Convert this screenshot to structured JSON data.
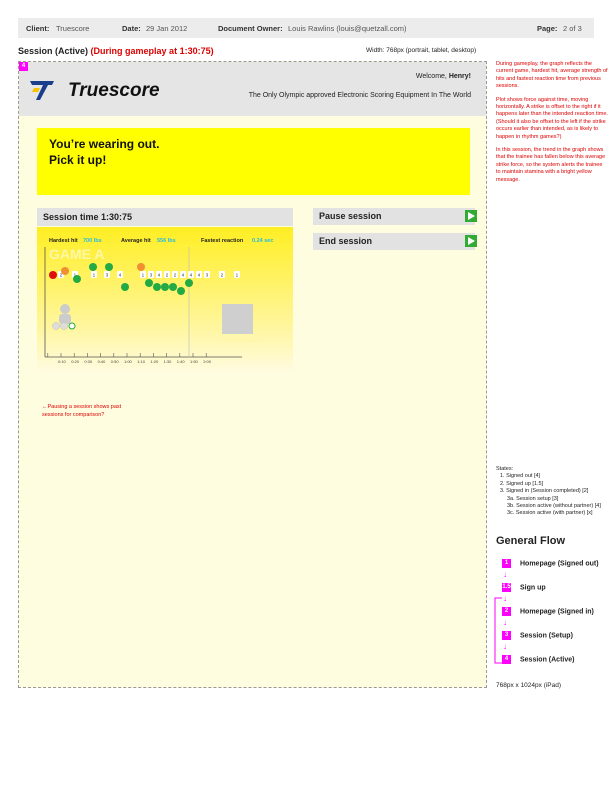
{
  "header": {
    "client_label": "Client:",
    "client": "Truescore",
    "date_label": "Date:",
    "date": "29 Jan 2012",
    "owner_label": "Document Owner:",
    "owner": "Louis Rawlins (louis@quetzall.com)",
    "page_label": "Page:",
    "page": "2 of 3"
  },
  "title": {
    "main": "Session (Active)",
    "highlight": "(During gameplay at 1:30:75)"
  },
  "width_note": "Width: 768px (portrait, tablet, desktop)",
  "screen": {
    "badge": "4",
    "brand": "Truescore",
    "welcome_prefix": "Welcome, ",
    "welcome_name": "Henry!",
    "tagline": "The Only Olympic approved Electronic Scoring Equipment In The World",
    "alert_line1": "You’re wearing out.",
    "alert_line2": "Pick it up!",
    "session_time": "Session time 1:30:75",
    "pause_button": "Pause session",
    "end_button": "End session",
    "pause_note": "←Pausing a session shows past sessions for comparison?"
  },
  "chart_data": {
    "type": "scatter",
    "title": "GAME A",
    "stats": {
      "hardest_label": "Hardest hit",
      "hardest_value": "700 lbs",
      "average_label": "Average hit",
      "average_value": "556 lbs",
      "fastest_label": "Fastest reaction",
      "fastest_value": "0.24 sec"
    },
    "x_ticks": [
      "0:10",
      "0:20",
      "0:30",
      "0:40",
      "0:50",
      "1:00",
      "1:10",
      "1:20",
      "1:30",
      "1:40",
      "1:50",
      "2:00"
    ],
    "current_time": "1:30",
    "image_label": "FOR YOUR BOOK",
    "hit_labels": [
      "2",
      "1",
      "1",
      "3",
      "4",
      "1",
      "3",
      "4",
      "2",
      "2",
      "4",
      "4",
      "4",
      "3",
      "2",
      "1"
    ],
    "colors": {
      "strong": "#22aa44",
      "weak": "#f09030",
      "miss": "#e01010",
      "accent": "#22bbdd"
    }
  },
  "side_notes": [
    "During gameplay, the graph reflects the current game, hardest hit, average strength of hits and fastest reaction time from previous sessions.",
    "Plot shows force against time, moving horizontally. A strike is offset to the right if it happens later than the intended reaction time. (Should it also be offset to the left if the strike occurs earlier than intended, as is likely to happen in rhythm games?)",
    "In this session, the trend in the graph shows that the trainee has fallen below this average strike force, so the system alerts the trainee to maintain stamina with a bright yellow message."
  ],
  "states": {
    "title": "States:",
    "items": [
      "1. Signed out [4]",
      "2. Signed up [1.5]",
      "3. Signed in (Session completed) [2]",
      "3a. Session setup [3]",
      "3b. Session active (without partner) [4]",
      "3c. Session active (with partner) [x]"
    ]
  },
  "flow": {
    "title": "General Flow",
    "steps": [
      {
        "badge": "1",
        "label": "Homepage (Signed out)"
      },
      {
        "badge": "1.5",
        "label": "Sign up"
      },
      {
        "badge": "2",
        "label": "Homepage (Signed in)"
      },
      {
        "badge": "3",
        "label": "Session (Setup)"
      },
      {
        "badge": "4",
        "label": "Session (Active)"
      }
    ]
  },
  "ipad_note": "768px x 1024px (iPad)"
}
